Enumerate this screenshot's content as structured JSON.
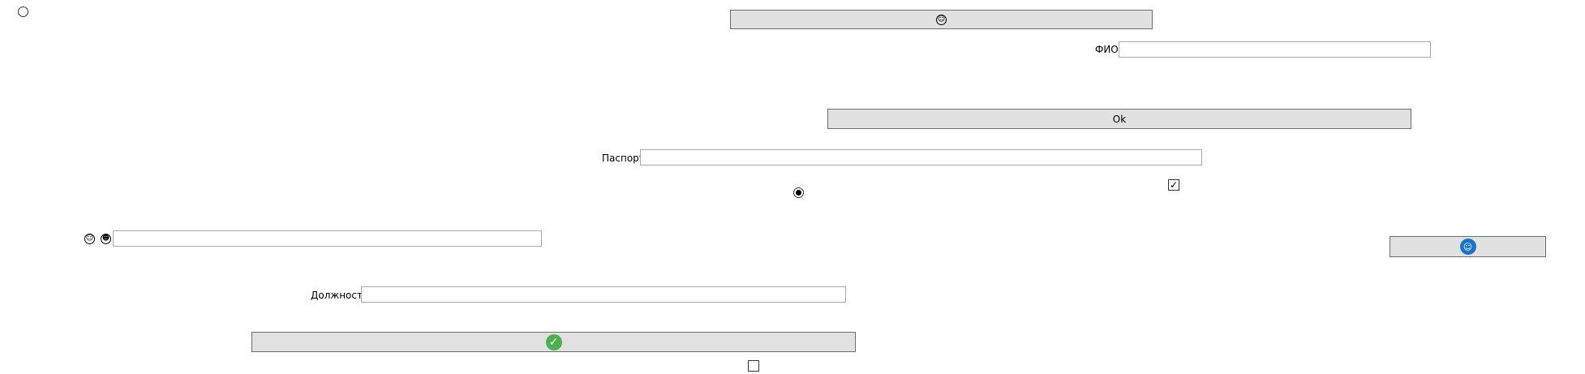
{
  "buttons": {
    "top_icon": "emoji-grin-icon",
    "ok_label": "Ok",
    "side_icon": "user-badge-icon",
    "confirm_icon": "check-circle-icon"
  },
  "fields": {
    "fio": {
      "label": "ФИО",
      "value": ""
    },
    "passport": {
      "label": "Паспорт",
      "value": ""
    },
    "position": {
      "label": "Должность",
      "value": ""
    },
    "emoji_field": {
      "value": ""
    }
  },
  "radios": [
    {
      "checked": false
    },
    {
      "checked": true
    }
  ],
  "checkboxes": [
    {
      "checked": true
    },
    {
      "checked": false
    }
  ],
  "glyphs": {
    "check": "✓",
    "smile_a": "☺",
    "smile_b": "☻"
  }
}
